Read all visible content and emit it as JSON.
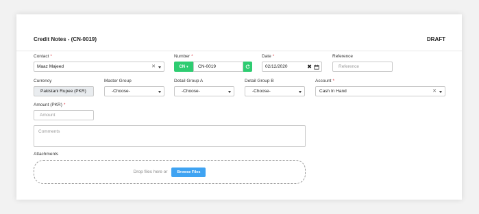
{
  "header": {
    "title": "Credit Notes - (CN-0019)",
    "status": "DRAFT"
  },
  "fields": {
    "contact": {
      "label": "Contact",
      "value": "Maaz Majeed"
    },
    "number": {
      "label": "Number",
      "prefix": "CN",
      "value": "CN-0019"
    },
    "date": {
      "label": "Date",
      "value": "02/12/2020"
    },
    "reference": {
      "label": "Reference",
      "placeholder": "Reference"
    },
    "currency": {
      "label": "Currency",
      "value": "Pakistani Rupee (PKR)"
    },
    "master_group": {
      "label": "Master Group",
      "value": "-Choose-"
    },
    "detail_group_a": {
      "label": "Detail Group A",
      "value": "-Choose-"
    },
    "detail_group_b": {
      "label": "Detail Group B",
      "value": "-Choose-"
    },
    "account": {
      "label": "Account",
      "value": "Cash In Hand"
    },
    "amount": {
      "label": "Amount (PKR)",
      "placeholder": "Amount"
    },
    "comments": {
      "placeholder": "Comments"
    }
  },
  "attachments": {
    "label": "Attachments",
    "drop_text": "Drop files here or",
    "browse_label": "Browse Files"
  },
  "required_mark": "*",
  "colors": {
    "accent_green": "#2ecc71",
    "accent_blue": "#3fa3f2",
    "required": "#e0424a"
  }
}
